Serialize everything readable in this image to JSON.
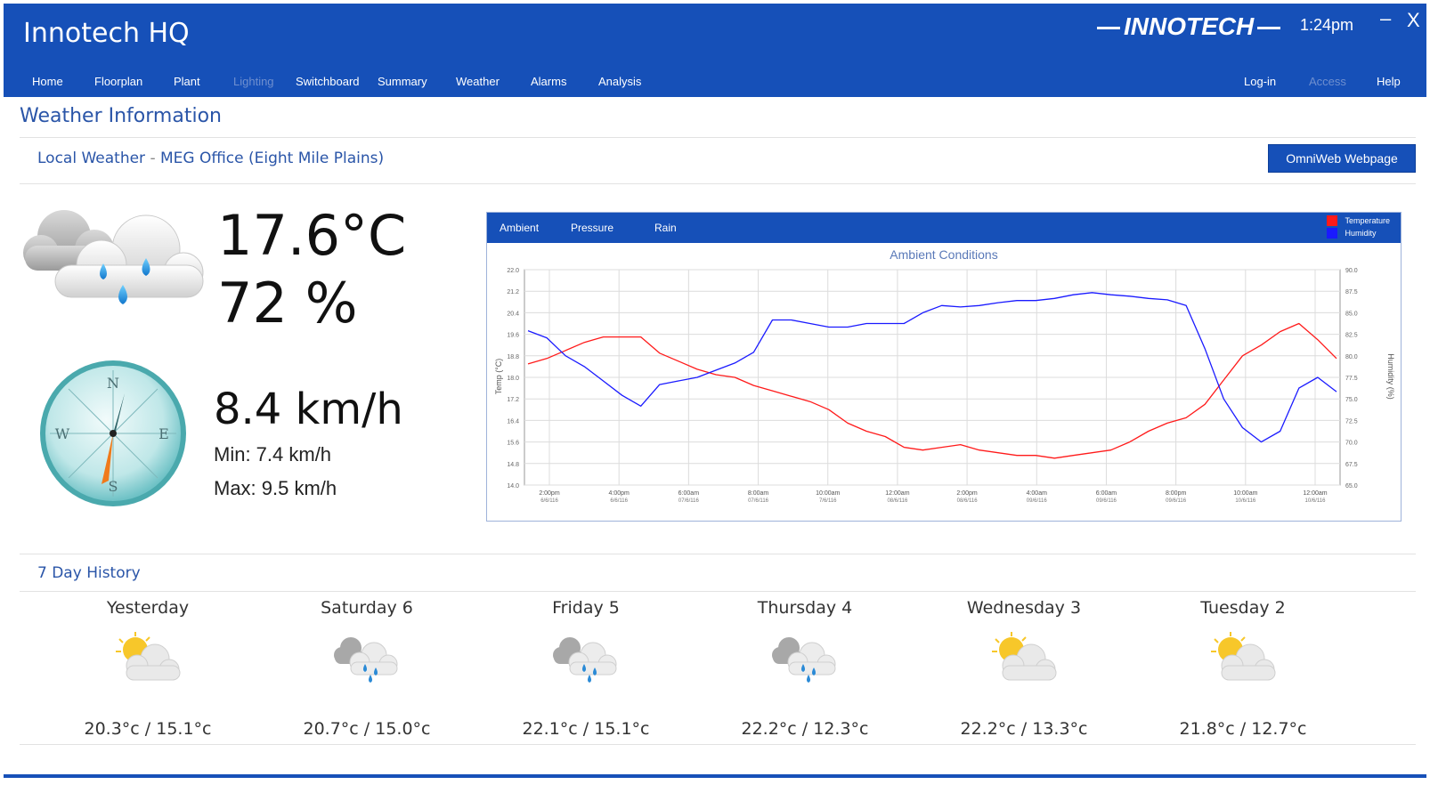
{
  "header": {
    "title": "Innotech HQ",
    "brand": "INNOTECH",
    "clock": "1:24pm",
    "minimize": "–",
    "close": "X",
    "nav_left": [
      "Home",
      "Floorplan",
      "Plant",
      "Lighting",
      "Switchboard",
      "Summary",
      "Weather",
      "Alarms",
      "Analysis"
    ],
    "nav_right": [
      "Log-in",
      "Access",
      "Help"
    ]
  },
  "page": {
    "title": "Weather Information"
  },
  "local_weather": {
    "label": "Local Weather",
    "separator": "-",
    "location": "MEG Office (Eight Mile Plains)",
    "button": "OmniWeb Webpage"
  },
  "current": {
    "icon": "rain-cloud-icon",
    "temperature": "17.6°C",
    "humidity": "72 %",
    "wind_icon": "compass-icon",
    "wind_speed": "8.4 km/h",
    "wind_min": "Min: 7.4 km/h",
    "wind_max": "Max: 9.5 km/h",
    "compass_labels": [
      "N",
      "E",
      "S",
      "W"
    ]
  },
  "chart_panel": {
    "tabs": [
      "Ambient",
      "Pressure",
      "Rain"
    ],
    "legend": [
      {
        "name": "Temperature",
        "color": "#ff1a1a"
      },
      {
        "name": "Humidity",
        "color": "#1a1aff"
      }
    ]
  },
  "chart_data": {
    "type": "line",
    "title": "Ambient Conditions",
    "ylabel": "Temp (°C)",
    "y2label": "Humidity (%)",
    "ylim": [
      14.0,
      22.0
    ],
    "y2lim": [
      60.0,
      90.0
    ],
    "yticks": [
      "22.0",
      "21.2",
      "20.4",
      "19.6",
      "18.8",
      "18.0",
      "17.2",
      "16.4",
      "15.6",
      "14.8",
      "14.0"
    ],
    "y2ticks": [
      "90.0",
      "87.5",
      "85.0",
      "82.5",
      "80.0",
      "77.5",
      "75.0",
      "72.5",
      "70.0",
      "67.5",
      "65.0"
    ],
    "xticks": [
      [
        "2:00pm",
        "6/6/116"
      ],
      [
        "4:00pm",
        "6/6/116"
      ],
      [
        "6:00am",
        "07/6/116"
      ],
      [
        "8:00am",
        "07/6/116"
      ],
      [
        "10:00am",
        "7/6/116"
      ],
      [
        "12:00am",
        "08/6/116"
      ],
      [
        "2:00pm",
        "08/6/116"
      ],
      [
        "4:00am",
        "09/6/116"
      ],
      [
        "6:00am",
        "09/6/116"
      ],
      [
        "8:00pm",
        "09/6/116"
      ],
      [
        "10:00am",
        "10/6/116"
      ],
      [
        "12:00am",
        "10/6/116"
      ]
    ],
    "series": [
      {
        "name": "Temperature",
        "color": "#ff1a1a",
        "axis": "left",
        "values": [
          18.5,
          18.7,
          19.0,
          19.3,
          19.5,
          19.5,
          19.5,
          18.9,
          18.6,
          18.3,
          18.1,
          18.0,
          17.7,
          17.5,
          17.3,
          17.1,
          16.8,
          16.3,
          16.0,
          15.8,
          15.4,
          15.3,
          15.4,
          15.5,
          15.3,
          15.2,
          15.1,
          15.1,
          15.0,
          15.1,
          15.2,
          15.3,
          15.6,
          16.0,
          16.3,
          16.5,
          17.0,
          17.9,
          18.8,
          19.2,
          19.7,
          20.0,
          19.4,
          18.7
        ]
      },
      {
        "name": "Humidity",
        "color": "#1a1aff",
        "axis": "right",
        "values": [
          81.5,
          80.5,
          78.0,
          76.5,
          74.5,
          72.5,
          71.0,
          74.0,
          74.5,
          75.0,
          76.0,
          77.0,
          78.5,
          83.0,
          83.0,
          82.5,
          82.0,
          82.0,
          82.5,
          82.5,
          82.5,
          84.0,
          85.0,
          84.8,
          85.0,
          85.4,
          85.7,
          85.7,
          86.0,
          86.5,
          86.8,
          86.5,
          86.3,
          86.0,
          85.8,
          85.0,
          79.0,
          72.0,
          68.0,
          66.0,
          67.5,
          73.5,
          75.0,
          73.0
        ]
      }
    ]
  },
  "history": {
    "title": "7 Day History",
    "days": [
      {
        "name": "Yesterday",
        "icon": "partly-cloudy-icon",
        "temps": "20.3°c / 15.1°c"
      },
      {
        "name": "Saturday  6",
        "icon": "showers-icon",
        "temps": "20.7°c / 15.0°c"
      },
      {
        "name": "Friday  5",
        "icon": "showers-icon",
        "temps": "22.1°c / 15.1°c"
      },
      {
        "name": "Thursday  4",
        "icon": "showers-icon",
        "temps": "22.2°c / 12.3°c"
      },
      {
        "name": "Wednesday  3",
        "icon": "partly-cloudy-icon",
        "temps": "22.2°c / 13.3°c"
      },
      {
        "name": "Tuesday  2",
        "icon": "partly-cloudy-icon",
        "temps": "21.8°c / 12.7°c"
      }
    ]
  },
  "colors": {
    "brand_blue": "#1650b8",
    "link_blue": "#2a55a8",
    "temperature": "#ff1a1a",
    "humidity": "#1a1aff"
  }
}
